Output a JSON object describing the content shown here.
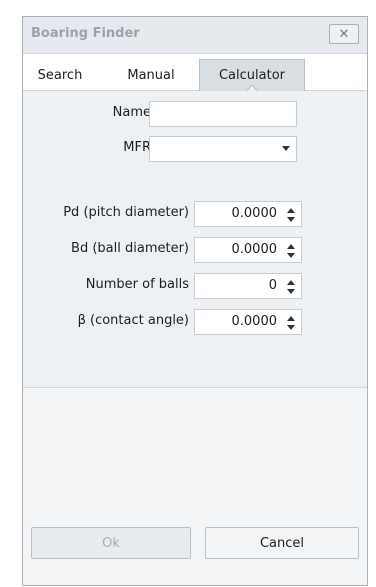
{
  "window": {
    "title": "Boaring Finder",
    "close_symbol": "✕"
  },
  "tabs": [
    {
      "label": "Search",
      "active": false
    },
    {
      "label": "Manual",
      "active": false
    },
    {
      "label": "Calculator",
      "active": true
    }
  ],
  "form": {
    "name_label": "Name",
    "name_value": "",
    "mfr_label": "MFR",
    "mfr_value": "",
    "pd_label": "Pd (pitch diameter)",
    "pd_value": "0.0000",
    "bd_label": "Bd (ball diameter)",
    "bd_value": "0.0000",
    "balls_label": "Number of balls",
    "balls_value": "0",
    "beta_label": "β (contact angle)",
    "beta_value": "0.0000"
  },
  "buttons": {
    "ok_label": "Ok",
    "ok_enabled": false,
    "cancel_label": "Cancel"
  },
  "colors": {
    "title_text": "#9aa2ab",
    "active_tab": "#d9dee3",
    "panel_bg": "#eef1f4",
    "disabled_text": "#a6adb5"
  },
  "icons": {
    "close": "close-icon",
    "dropdown": "chevron-down-icon",
    "spinner": "spin-updown-icon"
  }
}
